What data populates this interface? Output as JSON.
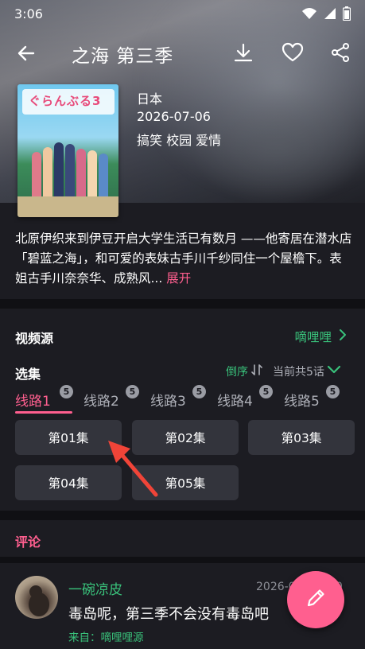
{
  "status_bar": {
    "time": "3:06"
  },
  "header": {
    "title": "之海 第三季"
  },
  "anime": {
    "country": "日本",
    "date": "2026-07-06",
    "tags": "搞笑 校园 爱情",
    "poster_logo": "ぐらんぶる3"
  },
  "synopsis": {
    "text": "北原伊织来到伊豆开启大学生活已有数月 ——他寄居在潜水店「碧蓝之海」，和可爱的表妹古手川千纱同住一个屋檐下。表姐古手川奈奈华、成熟风...",
    "more": "展开"
  },
  "video_source": {
    "label": "视频源",
    "value": "嘀哩哩"
  },
  "episodes": {
    "label": "选集",
    "order_label": "倒序",
    "total_label": "当前共5话",
    "lines": [
      {
        "label": "线路1",
        "count": "5"
      },
      {
        "label": "线路2",
        "count": "5"
      },
      {
        "label": "线路3",
        "count": "5"
      },
      {
        "label": "线路4",
        "count": "5"
      },
      {
        "label": "线路5",
        "count": "5"
      }
    ],
    "items": [
      "第01集",
      "第02集",
      "第03集",
      "第04集",
      "第05集"
    ]
  },
  "comments": {
    "label": "评论",
    "items": [
      {
        "user": "一碗凉皮",
        "date": "2026-0",
        "date_tail": "0",
        "text": "毒岛呢，第三季不会没有毒岛吧",
        "from": "来自：嘀哩哩源"
      }
    ]
  },
  "colors": {
    "accent": "#ff5f8f",
    "green": "#39c27b",
    "background": "#1c1c22"
  },
  "icons": [
    "back-arrow-icon",
    "download-icon",
    "heart-icon",
    "share-icon",
    "chevron-right-icon",
    "sort-icon",
    "chevron-down-icon",
    "pencil-icon",
    "wifi-icon",
    "signal-icon",
    "battery-icon"
  ]
}
